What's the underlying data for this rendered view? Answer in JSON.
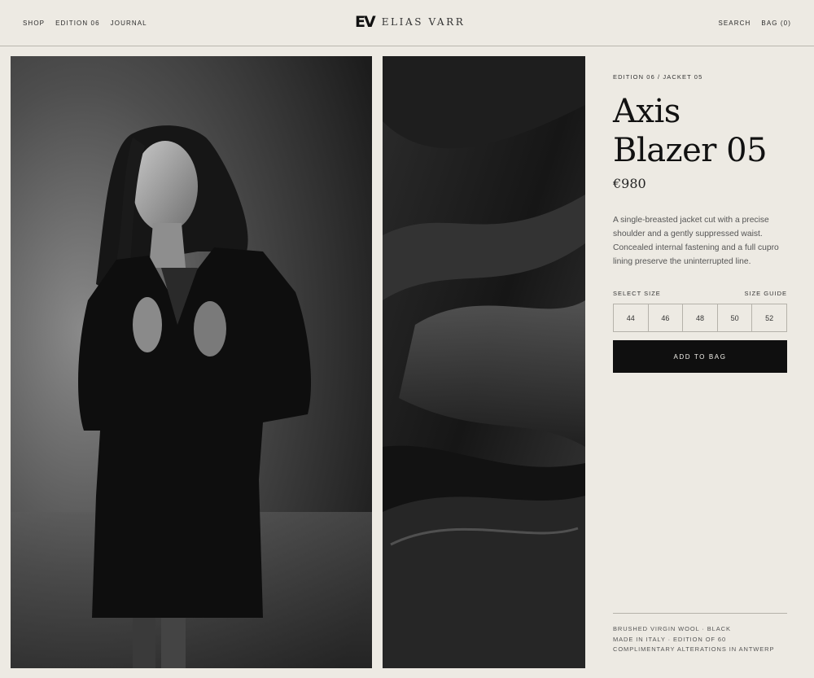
{
  "nav": {
    "left": [
      "SHOP",
      "EDITION 06",
      "JOURNAL"
    ],
    "right": [
      "SEARCH",
      "BAG (0)"
    ]
  },
  "brand": {
    "logo": "EV",
    "name": "ELIAS VARR"
  },
  "product": {
    "breadcrumb": "EDITION 06 / JACKET 05",
    "title": "Axis Blazer 05",
    "price": "€980",
    "description": "A single-breasted jacket cut with a precise shoulder and a gently suppressed waist. Concealed internal fastening and a full cupro lining preserve the uninterrupted line.",
    "size_label": "SELECT SIZE",
    "size_guide": "SIZE GUIDE",
    "sizes": [
      "44",
      "46",
      "48",
      "50",
      "52"
    ],
    "add_to_bag": "ADD TO BAG",
    "details": [
      "BRUSHED VIRGIN WOOL · BLACK",
      "MADE IN ITALY · EDITION OF 60",
      "COMPLIMENTARY ALTERATIONS IN ANTWERP"
    ]
  },
  "images": {
    "model": "model-photo",
    "fabric": "fabric-detail-photo"
  },
  "colors": {
    "background": "#edeae3",
    "button": "#0f0f0f",
    "rule": "#b5b2aa"
  }
}
